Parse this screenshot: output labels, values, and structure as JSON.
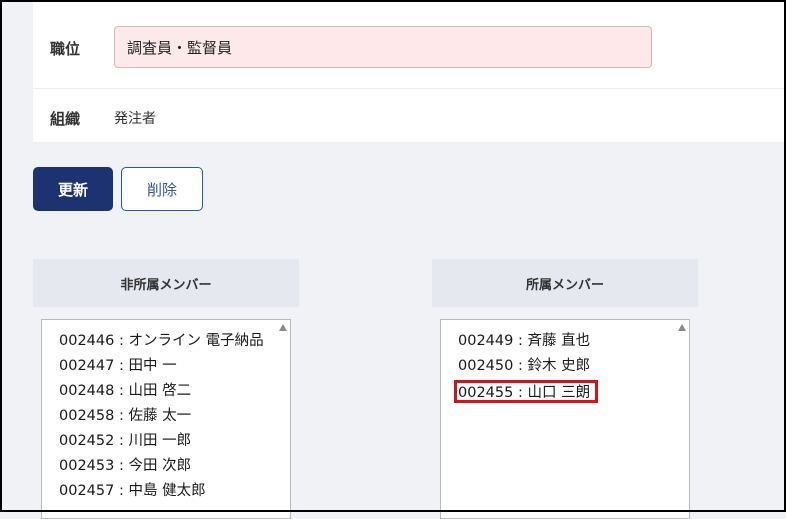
{
  "form": {
    "position_label": "職位",
    "position_value": "調査員・監督員",
    "org_label": "組織",
    "org_value": "発注者"
  },
  "buttons": {
    "update_label": "更新",
    "delete_label": "削除"
  },
  "non_members": {
    "header": "非所属メンバー",
    "items": [
      "002446 : オンライン 電子納品",
      "002447 : 田中 一",
      "002448 : 山田 啓二",
      "002458 : 佐藤 太一",
      "002452 : 川田 一郎",
      "002453 : 今田 次郎",
      "002457 : 中島 健太郎"
    ]
  },
  "members": {
    "header": "所属メンバー",
    "items": [
      "002449 : 斉藤 直也",
      "002450 : 鈴木 史郎",
      "002455 : 山口 三朗"
    ],
    "highlight_color": "#d0161c"
  },
  "colors": {
    "primary": "#1d3270",
    "input_error_bg": "#fde8ea",
    "header_bg": "#e5e8ee"
  }
}
